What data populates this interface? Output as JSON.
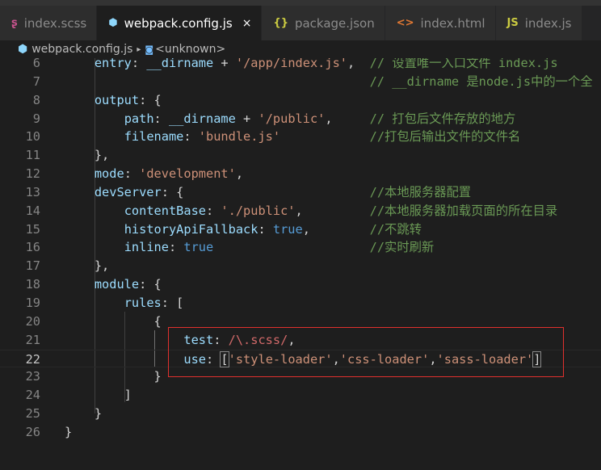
{
  "tabs": [
    {
      "label": "index.scss",
      "icon": "sass-icon",
      "glyph": "ʂ",
      "color": "#c6538c"
    },
    {
      "label": "webpack.config.js",
      "icon": "webpack-cube-icon",
      "glyph": "⬢",
      "color": "#8ed6fb",
      "active": true,
      "close": "×"
    },
    {
      "label": "package.json",
      "icon": "json-braces-icon",
      "glyph": "{}",
      "color": "#cbcb41"
    },
    {
      "label": "index.html",
      "icon": "html-code-icon",
      "glyph": "<>",
      "color": "#e37933"
    },
    {
      "label": "index.js",
      "icon": "js-icon",
      "glyph": "JS",
      "color": "#cbcb41"
    }
  ],
  "breadcrumb": {
    "file": "webpack.config.js",
    "separator": "▸",
    "symbol_icon": "◙",
    "symbol": "<unknown>"
  },
  "lines": [
    {
      "n": "6",
      "t": [
        [
          "p",
          "    "
        ],
        [
          "k",
          "entry"
        ],
        [
          "p",
          ": "
        ],
        [
          "k",
          "__dirname"
        ],
        [
          "p",
          " + "
        ],
        [
          "s",
          "'/app/index.js'"
        ],
        [
          "p",
          ",  "
        ],
        [
          "c",
          "// 设置唯一入口文件 index.js"
        ]
      ]
    },
    {
      "n": "7",
      "t": [
        [
          "p",
          "                                         "
        ],
        [
          "c",
          "// __dirname 是node.js中的一个全"
        ]
      ]
    },
    {
      "n": "8",
      "t": [
        [
          "p",
          "    "
        ],
        [
          "k",
          "output"
        ],
        [
          "p",
          ": {"
        ]
      ]
    },
    {
      "n": "9",
      "t": [
        [
          "p",
          "        "
        ],
        [
          "k",
          "path"
        ],
        [
          "p",
          ": "
        ],
        [
          "k",
          "__dirname"
        ],
        [
          "p",
          " + "
        ],
        [
          "s",
          "'/public'"
        ],
        [
          "p",
          ",     "
        ],
        [
          "c",
          "// 打包后文件存放的地方"
        ]
      ]
    },
    {
      "n": "10",
      "t": [
        [
          "p",
          "        "
        ],
        [
          "k",
          "filename"
        ],
        [
          "p",
          ": "
        ],
        [
          "s",
          "'bundle.js'"
        ],
        [
          "p",
          "            "
        ],
        [
          "c",
          "//打包后输出文件的文件名"
        ]
      ]
    },
    {
      "n": "11",
      "t": [
        [
          "p",
          "    },"
        ]
      ]
    },
    {
      "n": "12",
      "t": [
        [
          "p",
          "    "
        ],
        [
          "k",
          "mode"
        ],
        [
          "p",
          ": "
        ],
        [
          "s",
          "'development'"
        ],
        [
          "p",
          ","
        ]
      ]
    },
    {
      "n": "13",
      "t": [
        [
          "p",
          "    "
        ],
        [
          "k",
          "devServer"
        ],
        [
          "p",
          ": {                         "
        ],
        [
          "c",
          "//本地服务器配置"
        ]
      ]
    },
    {
      "n": "14",
      "t": [
        [
          "p",
          "        "
        ],
        [
          "k",
          "contentBase"
        ],
        [
          "p",
          ": "
        ],
        [
          "s",
          "'./public'"
        ],
        [
          "p",
          ",         "
        ],
        [
          "c",
          "//本地服务器加载页面的所在目录"
        ]
      ]
    },
    {
      "n": "15",
      "t": [
        [
          "p",
          "        "
        ],
        [
          "k",
          "historyApiFallback"
        ],
        [
          "p",
          ": "
        ],
        [
          "b",
          "true"
        ],
        [
          "p",
          ",        "
        ],
        [
          "c",
          "//不跳转"
        ]
      ]
    },
    {
      "n": "16",
      "t": [
        [
          "p",
          "        "
        ],
        [
          "k",
          "inline"
        ],
        [
          "p",
          ": "
        ],
        [
          "b",
          "true"
        ],
        [
          "p",
          "                     "
        ],
        [
          "c",
          "//实时刷新"
        ]
      ]
    },
    {
      "n": "17",
      "t": [
        [
          "p",
          "    },"
        ]
      ]
    },
    {
      "n": "18",
      "t": [
        [
          "p",
          "    "
        ],
        [
          "k",
          "module"
        ],
        [
          "p",
          ": {"
        ]
      ]
    },
    {
      "n": "19",
      "t": [
        [
          "p",
          "        "
        ],
        [
          "k",
          "rules"
        ],
        [
          "p",
          ": ["
        ]
      ]
    },
    {
      "n": "20",
      "t": [
        [
          "p",
          "            {"
        ]
      ]
    },
    {
      "n": "21",
      "t": [
        [
          "p",
          "                "
        ],
        [
          "k",
          "test"
        ],
        [
          "p",
          ": "
        ],
        [
          "r",
          "/\\.scss/"
        ],
        [
          "p",
          ","
        ]
      ]
    },
    {
      "n": "22",
      "cur": true,
      "t": [
        [
          "p",
          "                "
        ],
        [
          "k",
          "use"
        ],
        [
          "p",
          ": "
        ],
        [
          "brk",
          "["
        ],
        [
          "s",
          "'style-loader'"
        ],
        [
          "p",
          ","
        ],
        [
          "s",
          "'css-loader'"
        ],
        [
          "p",
          ","
        ],
        [
          "s",
          "'sass-loader'"
        ],
        [
          "brk",
          "]"
        ]
      ]
    },
    {
      "n": "23",
      "t": [
        [
          "p",
          "            }"
        ]
      ]
    },
    {
      "n": "24",
      "t": [
        [
          "p",
          "        ]"
        ]
      ]
    },
    {
      "n": "25",
      "t": [
        [
          "p",
          "    }"
        ]
      ]
    },
    {
      "n": "26",
      "t": [
        [
          "p",
          "}"
        ]
      ]
    }
  ]
}
